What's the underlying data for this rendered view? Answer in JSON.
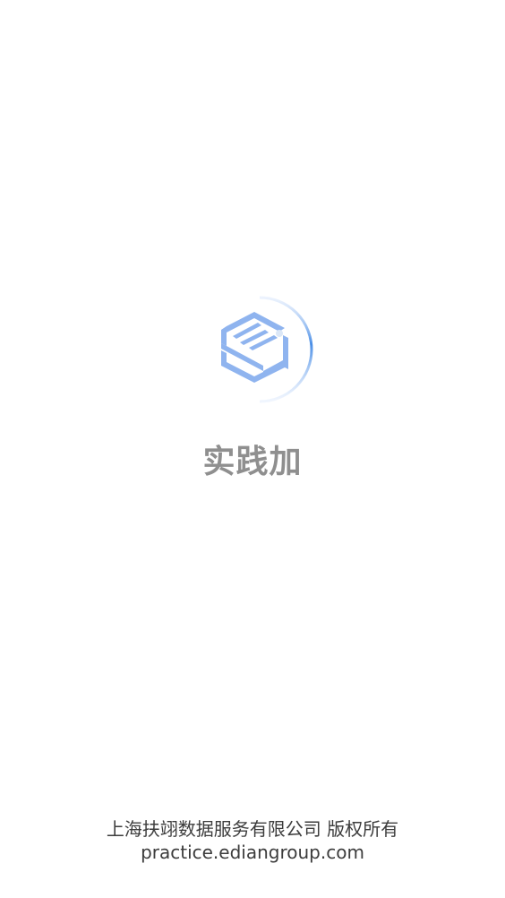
{
  "splash": {
    "app_name": "实践加",
    "logo_icon": "stacked-s-cube-logo",
    "brand_color": "#8fb4ef",
    "arc_color": "#4a8ee6"
  },
  "footer": {
    "copyright": "上海扶翊数据服务有限公司 版权所有",
    "website": "practice.ediangroup.com"
  }
}
